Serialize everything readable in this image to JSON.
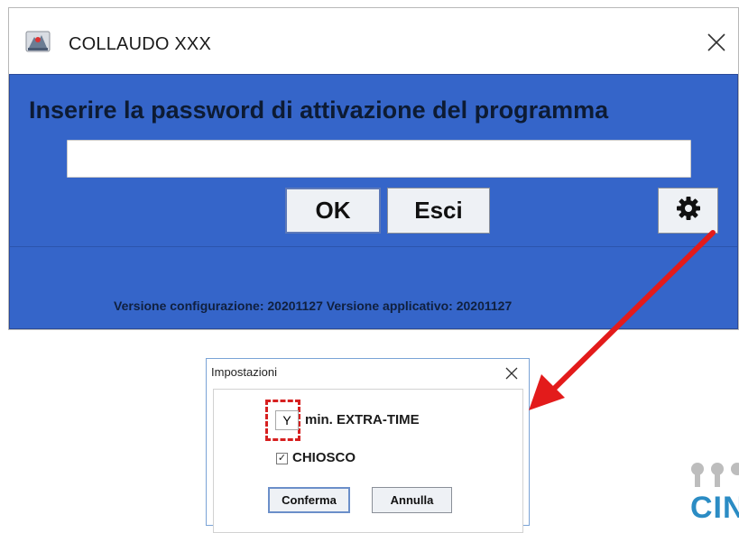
{
  "main_window": {
    "title": "COLLAUDO XXX",
    "heading": "Inserire la password di attivazione del programma",
    "password_value": "",
    "ok_label": "OK",
    "esci_label": "Esci",
    "version_text": "Versione configurazione: 20201127 Versione applicativo: 20201127"
  },
  "dialog": {
    "title": "Impostazioni",
    "extra_time_value": "Y",
    "extra_time_label": "min. EXTRA-TIME",
    "chiosco_checked": true,
    "chiosco_check_glyph": "✓",
    "chiosco_label": "CHIOSCO",
    "conferma_label": "Conferma",
    "annulla_label": "Annulla"
  },
  "logo": {
    "text": "CIN"
  },
  "colors": {
    "panel_blue": "#3565c9",
    "arrow_red": "#e31b1b",
    "dashed_red": "#d62020",
    "logo_blue": "#2b8cc4"
  },
  "icons": [
    "java-app-icon",
    "close-icon",
    "gear-icon",
    "dialog-close-icon",
    "checkbox-check-icon"
  ]
}
